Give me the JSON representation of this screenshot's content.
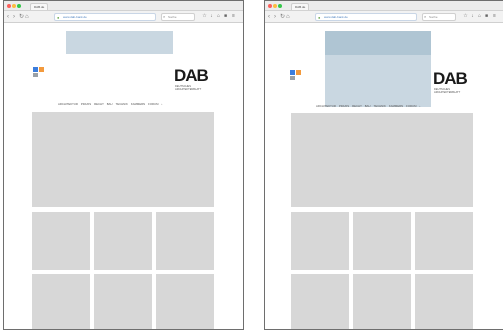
{
  "browser": {
    "tab_title": "DAB.de",
    "url": "www.dab-bank.de",
    "search_placeholder": "Suche"
  },
  "site": {
    "logo_text": "DAB",
    "logo_subtitle": "DEUTSCHES ARCHITEKTENBLATT",
    "nav_items": [
      "ARCHITEKTUR",
      "PRAXIS",
      "RECHT",
      "BAU",
      "TECHNIK",
      "KAMMERN",
      "FORUM"
    ],
    "nav_more": "›"
  },
  "colors": {
    "ad_placeholder": "#c9d7e1",
    "ad_placeholder_dark": "#afc5d3",
    "content_placeholder": "#d7d7d7",
    "logo_blue": "#3b7ddd",
    "logo_orange": "#f39a3d"
  },
  "icons": {
    "back": "back-arrow-icon",
    "forward": "forward-arrow-icon",
    "reload": "reload-icon",
    "home": "home-icon",
    "lock": "lock-icon",
    "search": "search-icon",
    "bookmark": "bookmark-icon",
    "download": "download-icon",
    "menu": "hamburger-menu-icon"
  }
}
